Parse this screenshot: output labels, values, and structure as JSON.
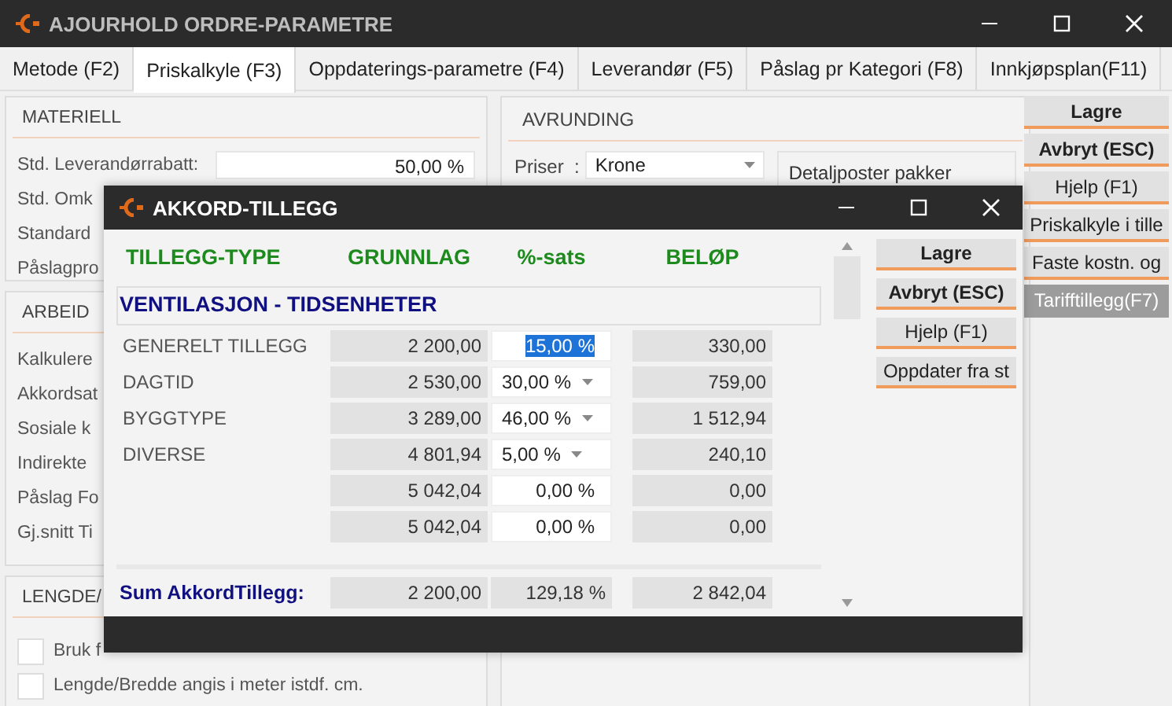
{
  "window": {
    "title": "AJOURHOLD ORDRE-PARAMETRE"
  },
  "tabs": [
    {
      "label": "Metode (F2)",
      "selected": false
    },
    {
      "label": "Priskalkyle (F3)",
      "selected": true
    },
    {
      "label": "Oppdaterings-parametre (F4)",
      "selected": false
    },
    {
      "label": "Leverandør (F5)",
      "selected": false
    },
    {
      "label": "Påslag pr Kategori (F8)",
      "selected": false
    },
    {
      "label": "Innkjøpsplan(F11)",
      "selected": false
    }
  ],
  "materiell": {
    "title": "MATERIELL",
    "rows": [
      {
        "label": "Std. Leverandørrabatt:",
        "value": "50,00 %"
      },
      {
        "label": "Std. Omk"
      },
      {
        "label": "Standard"
      },
      {
        "label": "Påslagpro"
      }
    ]
  },
  "arbeid": {
    "title": "ARBEID",
    "rows": [
      {
        "label": "Kalkulere"
      },
      {
        "label": "Akkordsat"
      },
      {
        "label": "Sosiale k"
      },
      {
        "label": "Indirekte"
      },
      {
        "label": "Påslag Fo"
      },
      {
        "label": "Gj.snitt Ti"
      }
    ]
  },
  "lengde": {
    "title": "LENGDE/",
    "checkboxes": [
      {
        "label": "Bruk f",
        "checked": false
      },
      {
        "label": "Lengde/Bredde angis i meter istdf. cm.",
        "checked": false
      }
    ]
  },
  "avrunding": {
    "title": "AVRUNDING",
    "priser_label": "Priser  :",
    "priser_value": "Krone",
    "detail_label": "Detaljposter pakker"
  },
  "side_buttons": [
    {
      "label": "Lagre",
      "bold": true,
      "selected": false
    },
    {
      "label": "Avbryt (ESC)",
      "bold": true,
      "selected": false
    },
    {
      "label": "Hjelp (F1)",
      "bold": false,
      "selected": false
    },
    {
      "label": "Priskalkyle i tille",
      "bold": false,
      "selected": false
    },
    {
      "label": "Faste kostn. og",
      "bold": false,
      "selected": false
    },
    {
      "label": "Tarifftillegg(F7)",
      "bold": false,
      "selected": true
    }
  ],
  "dialog": {
    "title": "AKKORD-TILLEGG",
    "columns": [
      "TILLEGG-TYPE",
      "GRUNNLAG",
      "%-sats",
      "BELØP"
    ],
    "section": "VENTILASJON - TIDSENHETER",
    "rows": [
      {
        "label": "GENERELT TILLEGG",
        "grunnlag": "2 200,00",
        "sats": "15,00 %",
        "belop": "330,00",
        "kind": "field",
        "highlighted": true
      },
      {
        "label": "DAGTID",
        "grunnlag": "2 530,00",
        "sats": "30,00 %",
        "belop": "759,00",
        "kind": "dropdown",
        "highlighted": false
      },
      {
        "label": "BYGGTYPE",
        "grunnlag": "3 289,00",
        "sats": "46,00 %",
        "belop": "1 512,94",
        "kind": "dropdown",
        "highlighted": false
      },
      {
        "label": "DIVERSE",
        "grunnlag": "4 801,94",
        "sats": "5,00 %",
        "belop": "240,10",
        "kind": "dropdown",
        "highlighted": false
      },
      {
        "grunnlag": "5 042,04",
        "sats": "0,00 %",
        "belop": "0,00",
        "kind": "field",
        "highlighted": false
      },
      {
        "grunnlag": "5 042,04",
        "sats": "0,00 %",
        "belop": "0,00",
        "kind": "field",
        "highlighted": false
      }
    ],
    "sum": {
      "label": "Sum AkkordTillegg:",
      "grunnlag": "2 200,00",
      "sats": "129,18 %",
      "belop": "2 842,04"
    },
    "buttons": [
      {
        "label": "Lagre",
        "bold": true
      },
      {
        "label": "Avbryt (ESC)",
        "bold": true
      },
      {
        "label": "Hjelp (F1)",
        "bold": false
      },
      {
        "label": "Oppdater fra st",
        "bold": false
      }
    ]
  }
}
